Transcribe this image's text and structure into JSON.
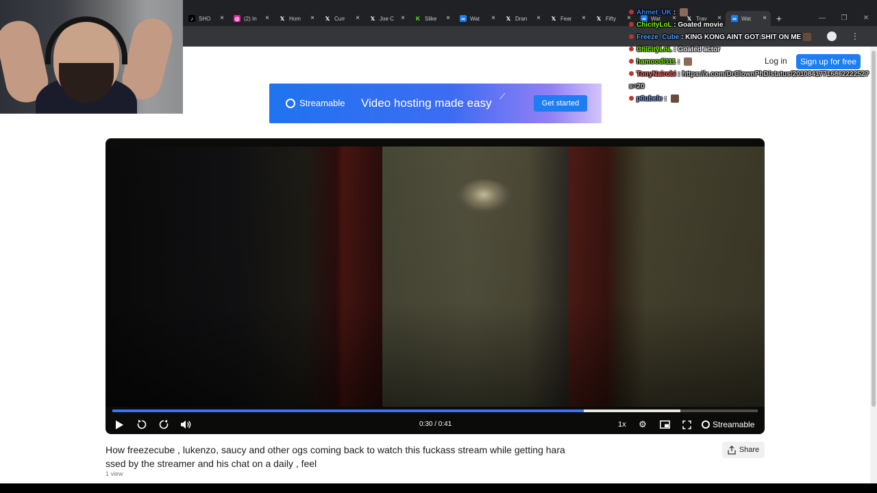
{
  "browser": {
    "tabs": [
      {
        "label": "SHO",
        "icon": "tiktok-icon",
        "icon_char": "♪",
        "icon_bg": "#000000",
        "icon_color": "#ffffff"
      },
      {
        "label": "(2) In",
        "icon": "instagram-icon",
        "icon_char": "◎",
        "icon_bg": "#d6249f",
        "icon_color": "#ffffff"
      },
      {
        "label": "Hom",
        "icon": "x-icon",
        "icon_char": "𝕏",
        "icon_bg": "transparent",
        "icon_color": "#ffffff"
      },
      {
        "label": "Curr",
        "icon": "x-icon",
        "icon_char": "𝕏",
        "icon_bg": "transparent",
        "icon_color": "#ffffff"
      },
      {
        "label": "Joe C",
        "icon": "x-icon",
        "icon_char": "𝕏",
        "icon_bg": "transparent",
        "icon_color": "#ffffff"
      },
      {
        "label": "Slike",
        "icon": "kick-icon",
        "icon_char": "K",
        "icon_bg": "transparent",
        "icon_color": "#53fc18"
      },
      {
        "label": "Wat",
        "icon": "streamable-icon",
        "icon_char": "∞",
        "icon_bg": "#1d7df2",
        "icon_color": "#ffffff"
      },
      {
        "label": "Dran",
        "icon": "x-icon",
        "icon_char": "𝕏",
        "icon_bg": "transparent",
        "icon_color": "#ffffff"
      },
      {
        "label": "Fear",
        "icon": "x-icon",
        "icon_char": "𝕏",
        "icon_bg": "transparent",
        "icon_color": "#ffffff"
      },
      {
        "label": "Fifty",
        "icon": "x-icon",
        "icon_char": "𝕏",
        "icon_bg": "transparent",
        "icon_color": "#ffffff"
      },
      {
        "label": "Wat",
        "icon": "streamable-icon",
        "icon_char": "∞",
        "icon_bg": "#1d7df2",
        "icon_color": "#ffffff"
      },
      {
        "label": "Trav",
        "icon": "x-icon",
        "icon_char": "𝕏",
        "icon_bg": "transparent",
        "icon_color": "#ffffff"
      },
      {
        "label": "Wat",
        "icon": "streamable-icon",
        "icon_char": "∞",
        "icon_bg": "#1d7df2",
        "icon_color": "#ffffff",
        "active": true
      }
    ],
    "new_tab": "+",
    "window_controls": [
      "—",
      "❐",
      "✕"
    ]
  },
  "site": {
    "login": "Log in",
    "signup": "Sign up for free"
  },
  "banner": {
    "brand": "Streamable",
    "tagline": "Video hosting made easy",
    "cta": "Get started",
    "colors": {
      "start": "#1f74f0",
      "end": "#d2c4fb",
      "cta": "#1d7df2"
    }
  },
  "player": {
    "time": "0:30 / 0:41",
    "progress": 0.73,
    "buffered": 0.88,
    "speed": "1x",
    "brand": "Streamable",
    "accent": "#3b73f0"
  },
  "video": {
    "title": "How freezecube , lukenzo, saucy and other ogs coming back to watch this fuckass stream while getting hara ssed by the streamer and his chat on a daily , feel",
    "views": "1 view",
    "share": "Share"
  },
  "chat": [
    {
      "user": "Ahmet_UK",
      "color": "#3f7fff",
      "text": "",
      "emote": true
    },
    {
      "user": "ChicityLoL",
      "color": "#7cfc00",
      "text": "Goated movie"
    },
    {
      "user": "Freeze_Cube",
      "color": "#4aa0ff",
      "text": "KING KONG AINT GOT SHIT ON ME",
      "emote": true
    },
    {
      "user": "ChicityLoL",
      "color": "#7cfc00",
      "text": "Goated actor"
    },
    {
      "user": "hamoodi111",
      "color": "#7cfc00",
      "text": "",
      "emote": true
    },
    {
      "user": "TonyNairobi",
      "color": "#ff6b6b",
      "text": "https://x.com/DrClownPhD/status/2010841771686222252?s=20",
      "faded": true
    },
    {
      "user": "p0ubele",
      "color": "#7aa7ff",
      "text": "",
      "emote": true
    }
  ]
}
